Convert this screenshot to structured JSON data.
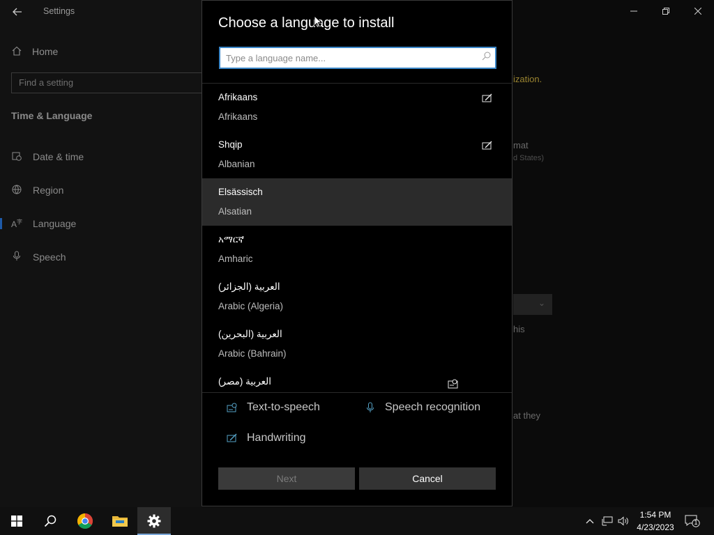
{
  "settings": {
    "app_title": "Settings",
    "home_label": "Home",
    "find_placeholder": "Find a setting",
    "section_title": "Time & Language",
    "nav_items": [
      {
        "label": "Date & time",
        "icon": "calendar-clock-icon"
      },
      {
        "label": "Region",
        "icon": "globe-icon"
      },
      {
        "label": "Language",
        "icon": "language-icon",
        "selected": true
      },
      {
        "label": "Speech",
        "icon": "microphone-icon"
      }
    ],
    "background_fragments": [
      "ization.",
      "mat",
      "d States)",
      "his",
      "at they"
    ]
  },
  "dialog": {
    "title": "Choose a language to install",
    "search_placeholder": "Type a language name...",
    "languages": [
      {
        "native": "Afrikaans",
        "english": "Afrikaans",
        "feature_icon": "handwriting-icon"
      },
      {
        "native": "Shqip",
        "english": "Albanian",
        "feature_icon": "handwriting-icon"
      },
      {
        "native": "Elsässisch",
        "english": "Alsatian",
        "feature_icon": ""
      },
      {
        "native": "አማርኛ",
        "english": "Amharic",
        "feature_icon": ""
      },
      {
        "native": "العربية (الجزائر)",
        "english": "Arabic (Algeria)",
        "feature_icon": ""
      },
      {
        "native": "العربية (البحرين)",
        "english": "Arabic (Bahrain)",
        "feature_icon": ""
      },
      {
        "native": "العربية (مصر)",
        "english": "",
        "feature_icon": "text-to-speech-icon"
      }
    ],
    "legend": {
      "tts_label": "Text-to-speech",
      "speech_label": "Speech recognition",
      "handwriting_label": "Handwriting"
    },
    "next_label": "Next",
    "cancel_label": "Cancel"
  },
  "taskbar": {
    "time": "1:54 PM",
    "date": "4/23/2023",
    "notification_count": "1"
  },
  "colors": {
    "accent": "#3a86c8",
    "legend_icon": "#56a3c8",
    "selected_row": "#2b2b2b"
  }
}
